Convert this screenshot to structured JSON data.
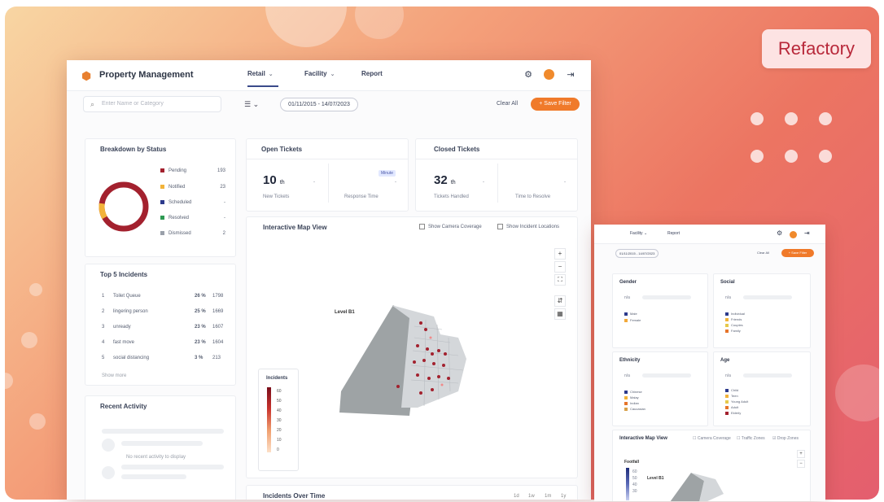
{
  "brand": {
    "badge": "Refactory"
  },
  "main": {
    "app_title": "Property Management",
    "nav": [
      {
        "label": "Retail"
      },
      {
        "label": "Facility"
      },
      {
        "label": "Report"
      }
    ],
    "icons": [
      "gear-icon",
      "avatar",
      "logout-icon"
    ],
    "search_placeholder": "Enter Name or Category",
    "date_range": "01/11/2015 - 14/07/2023",
    "clear_all": "Clear All",
    "save_filter": "+ Save Filter",
    "breakdown": {
      "title": "Breakdown by Status",
      "items": [
        {
          "label": "Pending",
          "count": "193",
          "color": "#a3212e"
        },
        {
          "label": "Notified",
          "count": "23",
          "color": "#f2b33a"
        },
        {
          "label": "Scheduled",
          "count": "-",
          "color": "#2c3a8c"
        },
        {
          "label": "Resolved",
          "count": "-",
          "color": "#2e9a52"
        },
        {
          "label": "Dismissed",
          "count": "2",
          "color": "#9aa0aa"
        }
      ]
    },
    "top_incidents": {
      "title": "Top 5 Incidents",
      "rows": [
        {
          "n": "1",
          "label": "Toilet Queue",
          "pct": "26 %",
          "value": "1798"
        },
        {
          "n": "2",
          "label": "lingering person",
          "pct": "25 %",
          "value": "1669"
        },
        {
          "n": "3",
          "label": "unready",
          "pct": "23 %",
          "value": "1607"
        },
        {
          "n": "4",
          "label": "fast move",
          "pct": "23 %",
          "value": "1604"
        },
        {
          "n": "5",
          "label": "social distancing",
          "pct": "3 %",
          "value": "213"
        }
      ],
      "show_more": "Show more"
    },
    "recent": {
      "title": "Recent Activity",
      "empty": "No recent activity to display"
    },
    "open_tickets": {
      "title": "Open Tickets",
      "value": "10",
      "unit": "th",
      "label": "New Tickets",
      "label2": "Response Time",
      "badge": "Minute",
      "dash": "-"
    },
    "closed_tickets": {
      "title": "Closed Tickets",
      "value": "32",
      "unit": "th",
      "label": "Tickets Handled",
      "label2": "Time to Resolve",
      "dash": "-"
    },
    "map": {
      "title": "Interactive Map View",
      "chk1": "Show Camera Coverage",
      "chk2": "Show Incident Locations",
      "level": "Level B1",
      "zoom_in": "+",
      "zoom_out": "−",
      "legend_title": "Incidents",
      "legend_ticks": [
        "60",
        "50",
        "40",
        "30",
        "20",
        "10",
        "0"
      ]
    },
    "over_time": {
      "title": "Incidents Over Time",
      "ranges": [
        "1d",
        "1w",
        "1m",
        "1y"
      ]
    }
  },
  "second": {
    "nav": [
      {
        "label": "Facility"
      },
      {
        "label": "Report"
      }
    ],
    "date_range": "01/11/2015 - 14/07/2023",
    "clear_all": "Clear All",
    "save_filter": "+ Save Filter",
    "cards": [
      {
        "title": "Gender",
        "legend": [
          "Male",
          "Female"
        ],
        "colors": [
          "#2c3a8c",
          "#f2a93a"
        ]
      },
      {
        "title": "Social",
        "legend": [
          "Individual",
          "Friends",
          "Couples",
          "Family"
        ],
        "colors": [
          "#2c3a8c",
          "#f2b33a",
          "#e6c94a",
          "#e6742a"
        ]
      },
      {
        "title": "Ethnicity",
        "legend": [
          "Chinese",
          "Malay",
          "Indian",
          "Caucasian"
        ],
        "colors": [
          "#2c3a8c",
          "#f2b33a",
          "#e6742a",
          "#d8a048"
        ]
      },
      {
        "title": "Age",
        "legend": [
          "Child",
          "Teen",
          "Young Adult",
          "Adult",
          "Elderly"
        ],
        "colors": [
          "#2c3a8c",
          "#f2b33a",
          "#e6c94a",
          "#e6742a",
          "#a3212e"
        ]
      }
    ],
    "map_title": "Interactive Map View",
    "chk": [
      "Camera Coverage",
      "Traffic Zones",
      "Drop Zones"
    ],
    "level": "Level B1",
    "legend_title": "Footfall",
    "legend_ticks": [
      "60",
      "50",
      "40",
      "30"
    ]
  }
}
